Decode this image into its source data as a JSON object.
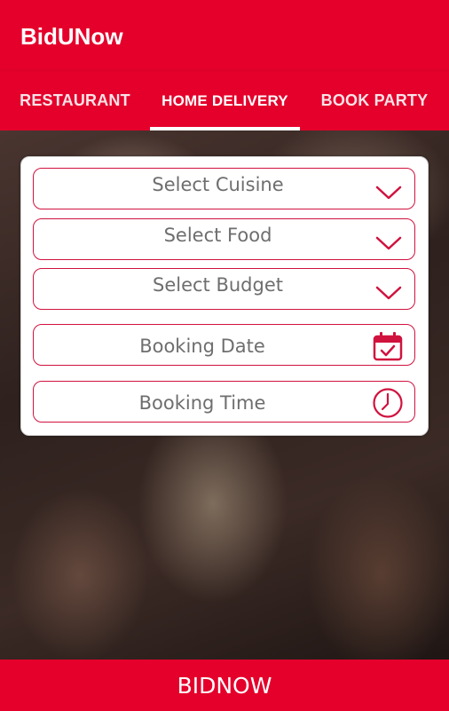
{
  "app": {
    "title": "BidUNow"
  },
  "tabs": [
    {
      "label": "RESTAURANT",
      "active": false
    },
    {
      "label": "HOME DELIVERY",
      "active": true
    },
    {
      "label": "BOOK PARTY",
      "active": false
    }
  ],
  "form": {
    "cuisine": "Select Cuisine",
    "food": "Select Food",
    "budget": "Select Budget",
    "date": "Booking Date",
    "time": "Booking Time"
  },
  "icons": {
    "dropdown": "chevron-down-icon",
    "date": "calendar-check-icon",
    "time": "clock-icon"
  },
  "colors": {
    "primary": "#E4002B",
    "field_border": "#D0123E",
    "label_text": "#6E6E6E"
  },
  "action": {
    "label": "BIDNOW"
  }
}
